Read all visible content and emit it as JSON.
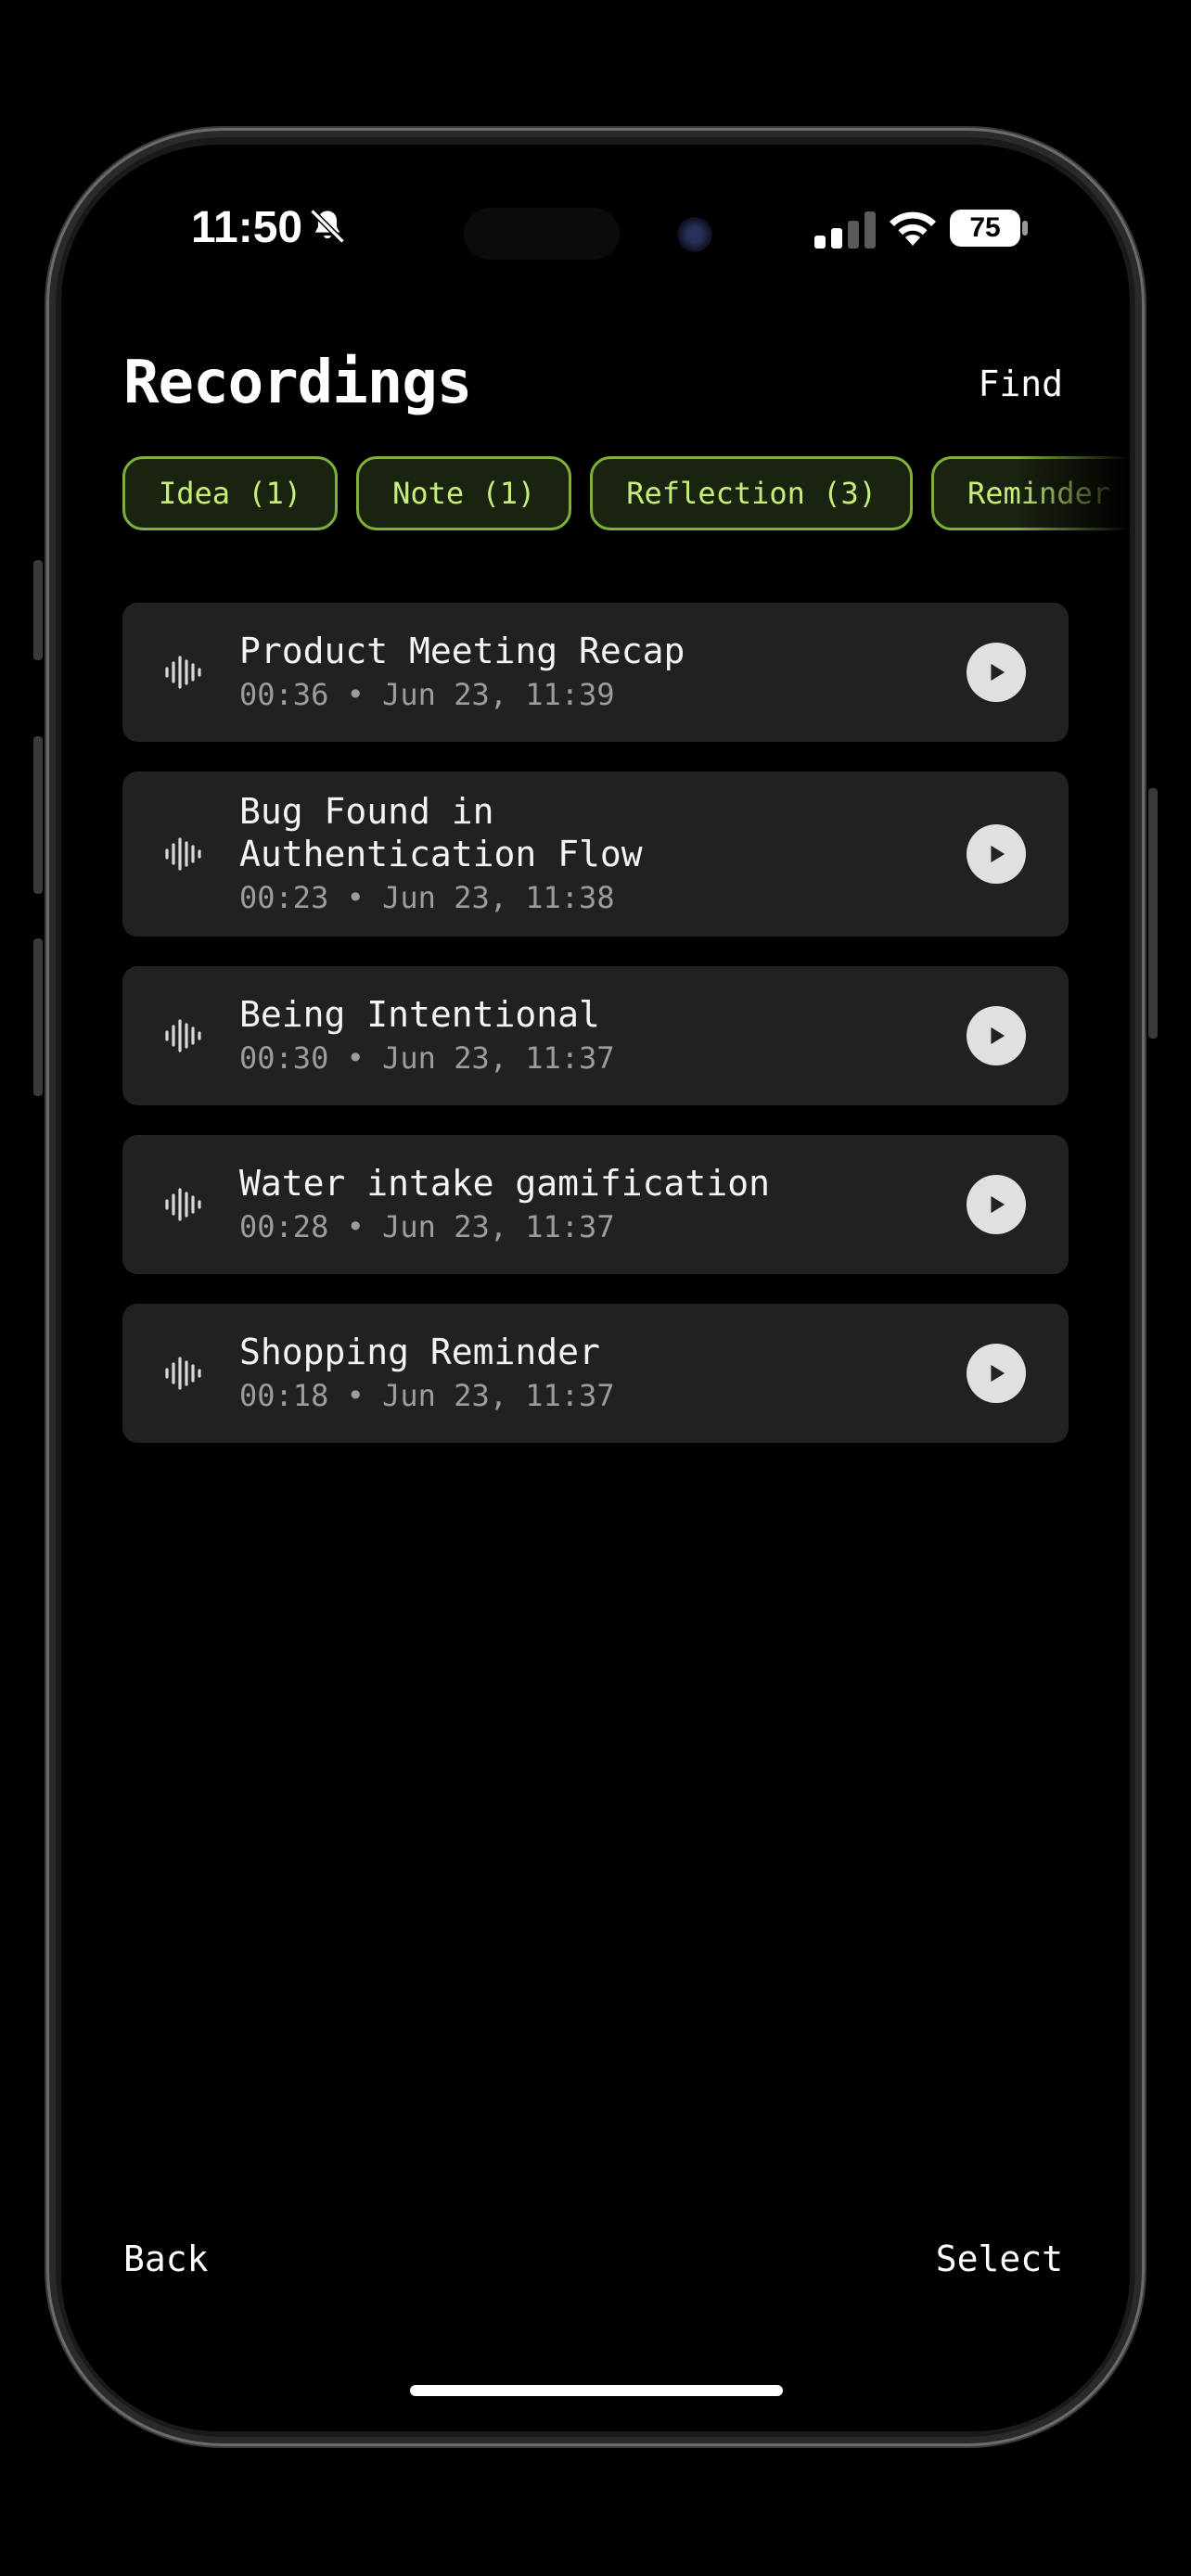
{
  "status_bar": {
    "time": "11:50",
    "battery": "75"
  },
  "header": {
    "title": "Recordings",
    "find_label": "Find"
  },
  "chips": [
    {
      "label": "Idea (1)"
    },
    {
      "label": "Note (1)"
    },
    {
      "label": "Reflection (3)"
    },
    {
      "label": "Reminder"
    }
  ],
  "recordings": [
    {
      "title": "Product Meeting Recap",
      "meta": "00:36 • Jun 23, 11:39"
    },
    {
      "title": "Bug Found in\nAuthentication Flow",
      "meta": "00:23 • Jun 23, 11:38"
    },
    {
      "title": "Being Intentional",
      "meta": "00:30 • Jun 23, 11:37"
    },
    {
      "title": "Water intake gamification",
      "meta": "00:28 • Jun 23, 11:37"
    },
    {
      "title": "Shopping Reminder",
      "meta": "00:18 • Jun 23, 11:37"
    }
  ],
  "footer": {
    "back_label": "Back",
    "select_label": "Select"
  },
  "icons": {
    "row_icon": "waveform-icon",
    "play_icon": "play-icon",
    "bell_icon": "bell-slash-icon"
  },
  "colors": {
    "chip_border": "#7fb03a",
    "chip_text": "#c6ef7a",
    "card_bg": "#212121"
  }
}
